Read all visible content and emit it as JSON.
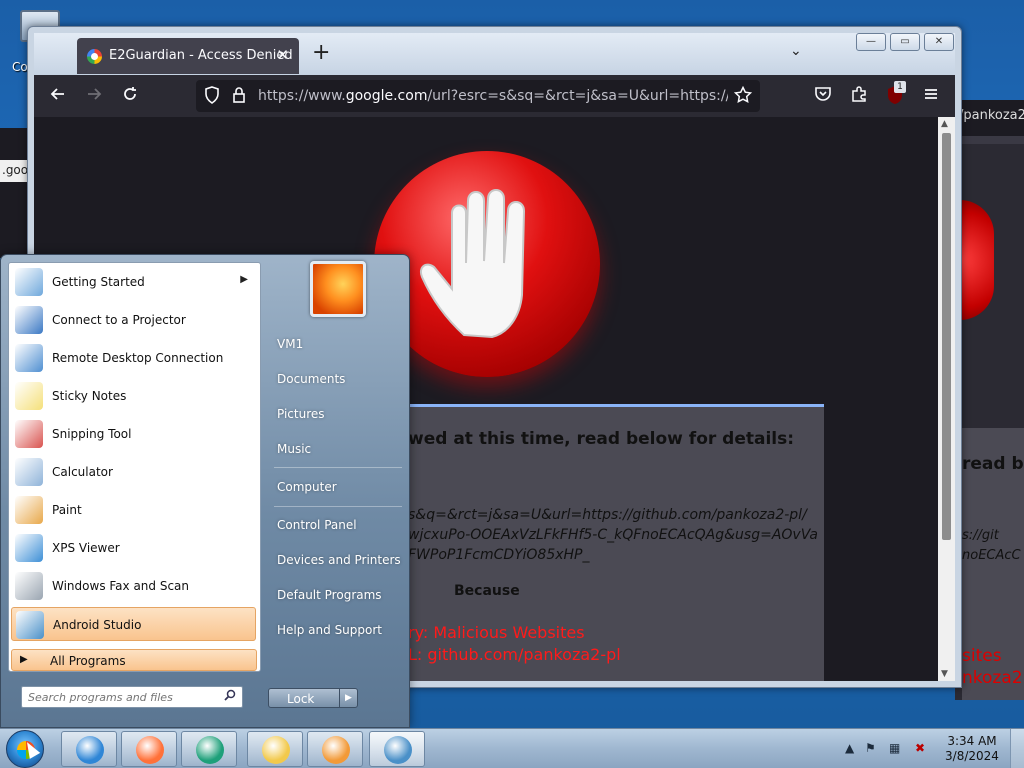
{
  "desktop": {
    "icon_label": "Co",
    "bg_address_fragment": ".goo",
    "bg_tab_fragment": "/pankoza2",
    "bg_message_fragment": "read be",
    "bg_url_line1": "s://git",
    "bg_url_line2": "noECAcC",
    "bg_cat_fragment": "sites",
    "bg_blk_fragment": "nkoza2"
  },
  "browser": {
    "tab_title": "E2Guardian - Access Denied",
    "tab_close": "✕",
    "new_tab": "+",
    "tab_list": "⌄",
    "url_prefix": "https://www.",
    "url_domain": "google.com",
    "url_rest": "/url?esrc=s&sq=&rct=j&sa=U&url=https://github.com",
    "badge_count": "1",
    "win_minimize": "—",
    "win_restore": "▭",
    "win_close": "✕"
  },
  "denied_page": {
    "message": "wed at this time, read below for details:",
    "url_line1": "s&q=&rct=j&sa=U&url=https://github.com/pankoza2-pl/",
    "url_line2": "wjcxuPo-OOEAxVzLFkFHf5-C_kQFnoECAcQAg&usg=AOvVa",
    "url_line3": "FWPoP1FcmCDYiO85xHP_",
    "because": "Because",
    "category": "ry: Malicious Websites",
    "blocked_url": "L: github.com/pankoza2-pl"
  },
  "start_menu": {
    "programs": [
      {
        "label": "Getting Started",
        "icon": "getting-started-icon",
        "has_submenu": true,
        "color": "#6fa8dc"
      },
      {
        "label": "Connect to a Projector",
        "icon": "projector-icon",
        "has_submenu": false,
        "color": "#3b79c4"
      },
      {
        "label": "Remote Desktop Connection",
        "icon": "remote-desktop-icon",
        "has_submenu": false,
        "color": "#4f8fd1"
      },
      {
        "label": "Sticky Notes",
        "icon": "sticky-notes-icon",
        "has_submenu": false,
        "color": "#f5e07a"
      },
      {
        "label": "Snipping Tool",
        "icon": "snipping-tool-icon",
        "has_submenu": false,
        "color": "#d9534f"
      },
      {
        "label": "Calculator",
        "icon": "calculator-icon",
        "has_submenu": false,
        "color": "#8fb3d9"
      },
      {
        "label": "Paint",
        "icon": "paint-icon",
        "has_submenu": false,
        "color": "#e8a84a"
      },
      {
        "label": "XPS Viewer",
        "icon": "xps-viewer-icon",
        "has_submenu": false,
        "color": "#3d8fd6"
      },
      {
        "label": "Windows Fax and Scan",
        "icon": "fax-scan-icon",
        "has_submenu": false,
        "color": "#9aa5b1"
      },
      {
        "label": "Android Studio",
        "icon": "android-studio-icon",
        "has_submenu": false,
        "color": "#4a90c8"
      }
    ],
    "all_programs": "All Programs",
    "search_placeholder": "Search programs and files",
    "right_links": {
      "user": "VM1",
      "documents": "Documents",
      "pictures": "Pictures",
      "music": "Music",
      "computer": "Computer",
      "control_panel": "Control Panel",
      "devices_printers": "Devices and Printers",
      "default_programs": "Default Programs",
      "help_support": "Help and Support"
    },
    "lock_label": "Lock"
  },
  "taskbar": {
    "time": "3:34 AM",
    "date": "3/8/2024",
    "apps": [
      {
        "name": "internet-explorer",
        "color": "#2f86d6"
      },
      {
        "name": "firefox",
        "color": "#ff7139"
      },
      {
        "name": "edge",
        "color": "#1ea07a"
      },
      {
        "name": "file-explorer",
        "color": "#f2c94c"
      },
      {
        "name": "media-player",
        "color": "#f29a38"
      },
      {
        "name": "android-studio",
        "color": "#4a90c8"
      }
    ]
  }
}
